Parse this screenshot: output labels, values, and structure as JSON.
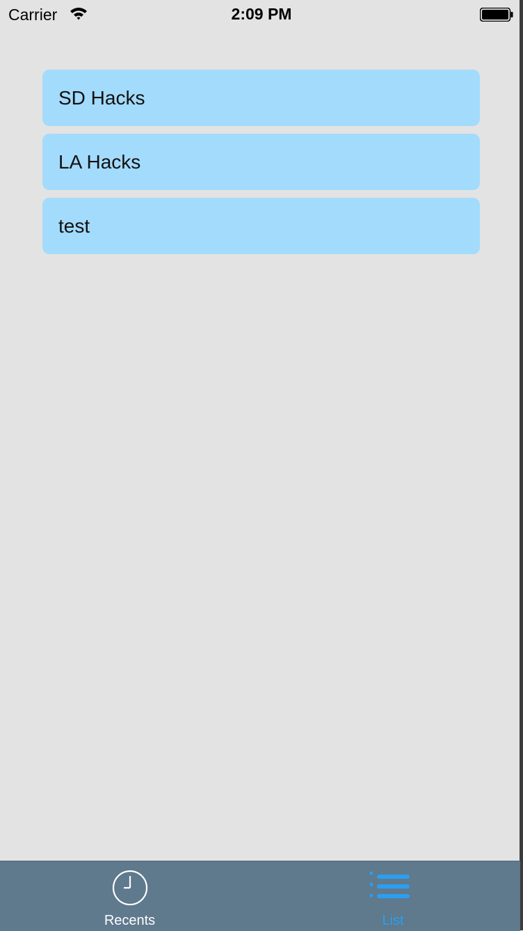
{
  "status_bar": {
    "carrier": "Carrier",
    "time": "2:09 PM",
    "wifi_icon": "wifi-icon",
    "battery_icon": "battery-icon"
  },
  "list": {
    "items": [
      {
        "label": "SD Hacks"
      },
      {
        "label": "LA Hacks"
      },
      {
        "label": "test"
      }
    ],
    "item_color": "#a3dbfc"
  },
  "tab_bar": {
    "background": "#5f798d",
    "tabs": [
      {
        "label": "Recents",
        "icon": "clock-icon",
        "selected": false
      },
      {
        "label": "List",
        "icon": "list-icon",
        "selected": true
      }
    ],
    "selected_color": "#2a9ff2"
  }
}
